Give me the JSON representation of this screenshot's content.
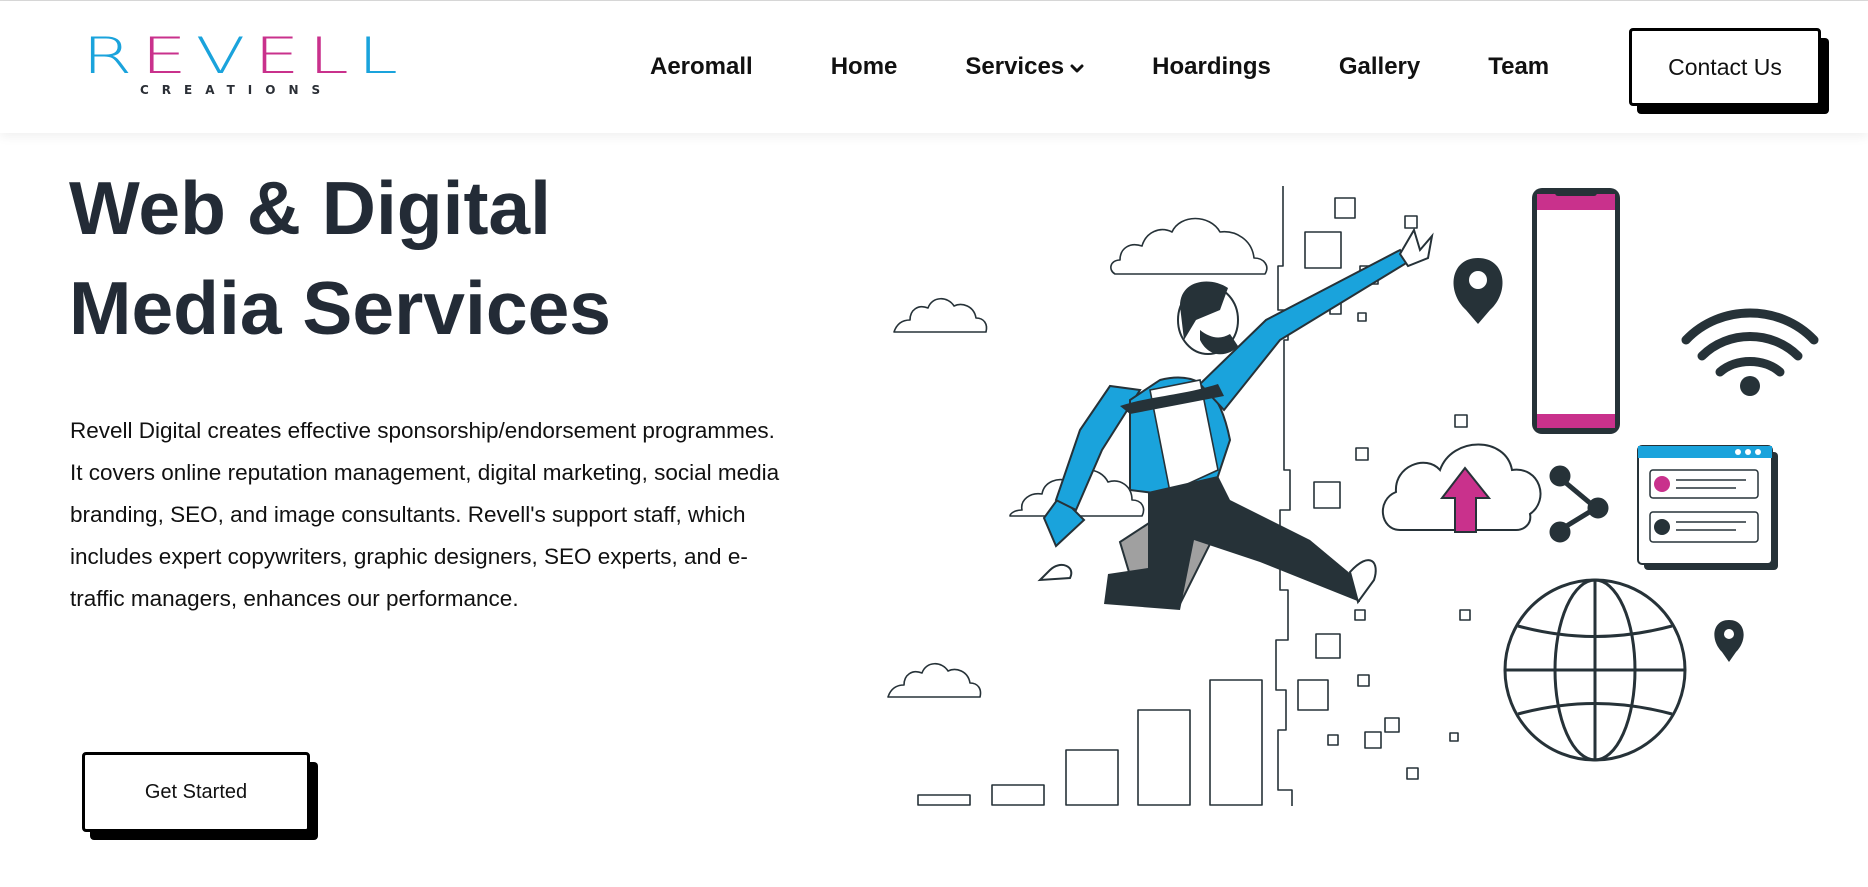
{
  "brand": {
    "logo_word": "REVELL",
    "logo_subtitle": "CREATIONS",
    "colors": {
      "cyan": "#1aa3dc",
      "magenta": "#c9318c",
      "dark": "#263238"
    }
  },
  "nav": {
    "items": [
      "Aeromall",
      "Home",
      "Services",
      "Hoardings",
      "Gallery",
      "Team"
    ],
    "contact_label": "Contact Us"
  },
  "hero": {
    "title_line1": "Web & Digital",
    "title_line2": "Media Services",
    "paragraph": "Revell Digital creates effective sponsorship/endorsement programmes. It covers online reputation management, digital marketing, social media branding, SEO, and image consultants. Revell's support staff, which includes expert copywriters, graphic designers, SEO experts, and e-traffic managers, enhances our performance.",
    "cta_label": "Get Started"
  },
  "icons": {
    "services_dropdown": "chevron-down-icon",
    "illustration": "digital-marketing-illustration"
  }
}
